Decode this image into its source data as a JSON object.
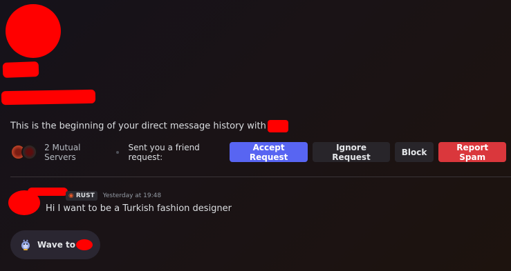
{
  "intro": {
    "text": "This is the beginning of your direct message history with"
  },
  "mutual": {
    "text": "2 Mutual Servers"
  },
  "friend_request": {
    "label": "Sent you a friend request:",
    "accept": "Accept Request",
    "ignore": "Ignore Request",
    "block": "Block",
    "report": "Report Spam"
  },
  "message": {
    "tag": "RUST",
    "timestamp": "Yesterday at 19:48",
    "text": "Hi I want to be a Turkish fashion designer"
  },
  "wave": {
    "label": "Wave to"
  },
  "colors": {
    "accept": "#5865f2",
    "report": "#da373c",
    "redaction": "#ff0000"
  }
}
